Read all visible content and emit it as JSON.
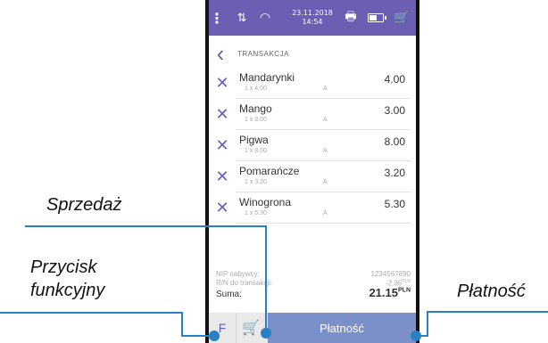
{
  "status_bar": {
    "menu_icon": "dots-vertical-icon",
    "sync_icon": "arrows-up-down-icon",
    "wifi_icon": "wifi-icon",
    "date": "23.11.2018",
    "time": "14:54",
    "printer_icon": "printer-icon",
    "battery_icon": "battery-icon",
    "battery_level": 0.6,
    "cart_icon": "cart-icon"
  },
  "header": {
    "back_icon": "chevron-left-icon",
    "title": "TRANSAKCJA"
  },
  "items": [
    {
      "name": "Mandarynki",
      "detail": "1 x 4.00",
      "vat": "A",
      "price": "4.00"
    },
    {
      "name": "Mango",
      "detail": "1 x 3.00",
      "vat": "A",
      "price": "3.00"
    },
    {
      "name": "Pigwa",
      "detail": "1 x 8.00",
      "vat": "A",
      "price": "8.00"
    },
    {
      "name": "Pomarańcze",
      "detail": "1 x 3.20",
      "vat": "A",
      "price": "3.20"
    },
    {
      "name": "Winogrona",
      "detail": "1 x 5.30",
      "vat": "A",
      "price": "5.30"
    }
  ],
  "summary": {
    "nip_label": "NIP nabywcy:",
    "nip_value": "1234567890",
    "discount_label": "R/N do transakcji:",
    "discount_value": "-2.35",
    "discount_currency": "PLN",
    "sum_label": "Suma:",
    "sum_value": "21.15",
    "sum_currency": "PLN"
  },
  "bottom_bar": {
    "function_label": "F",
    "cart_icon": "cart-add-icon",
    "pay_label": "Płatność"
  },
  "annotations": {
    "sale": "Sprzedaż",
    "function_line1": "Przycisk",
    "function_line2": "funkcyjny",
    "payment": "Płatność"
  },
  "colors": {
    "accent": "#6a5fb3",
    "pay_button": "#7b8fc9",
    "leader": "#2b80c5"
  }
}
